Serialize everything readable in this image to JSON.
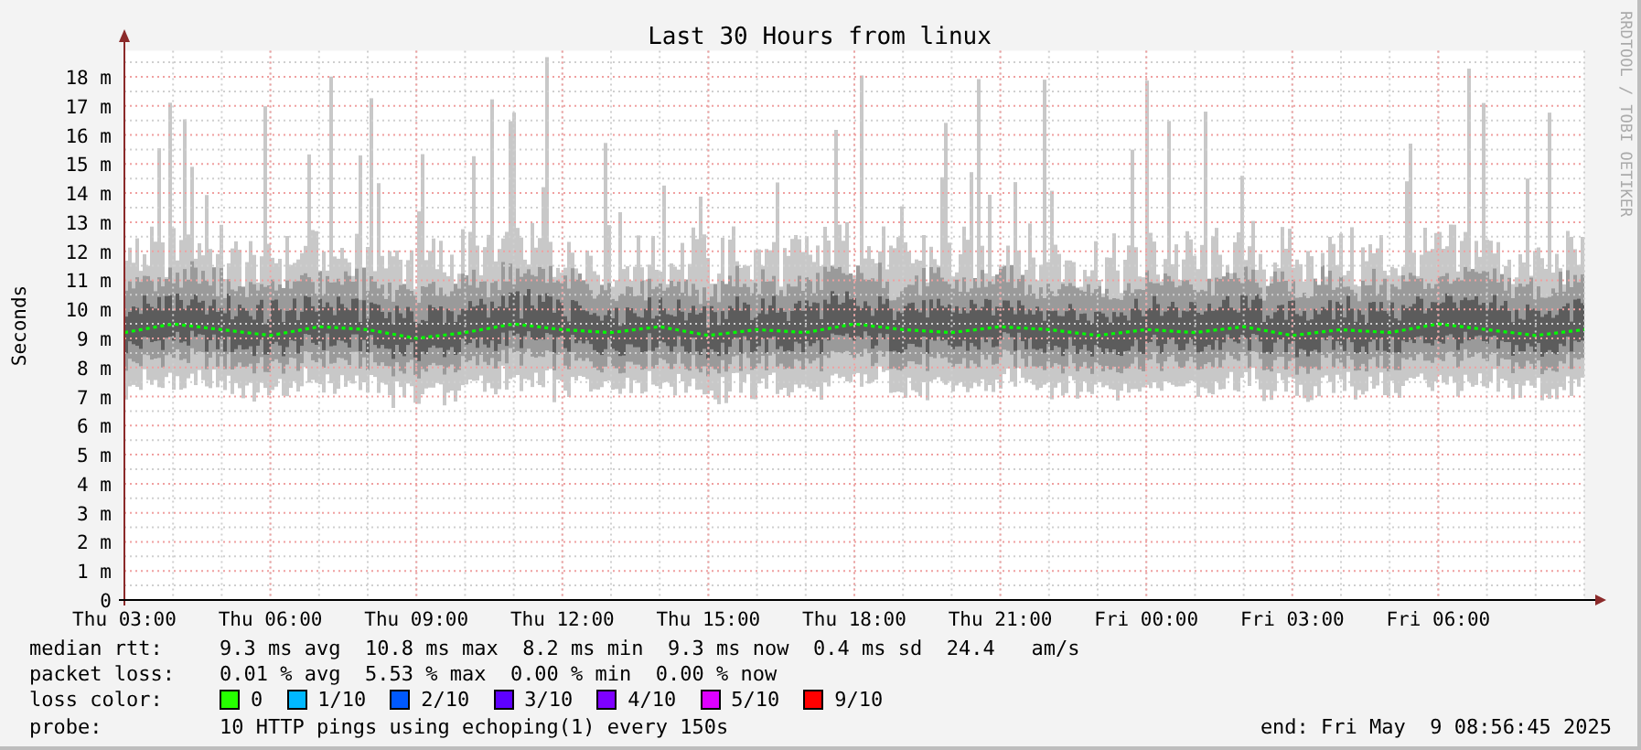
{
  "chart": {
    "chart_data": {
      "type": "line",
      "title": "Last 30 Hours from linux",
      "ylabel": "Seconds",
      "ylim": [
        0,
        18.9
      ],
      "categories": [
        "Thu 03:00",
        null,
        null,
        "Thu 06:00",
        null,
        null,
        "Thu 09:00",
        null,
        null,
        "Thu 12:00",
        null,
        null,
        "Thu 15:00",
        null,
        null,
        "Thu 18:00",
        null,
        null,
        "Thu 21:00",
        null,
        null,
        "Fri 00:00",
        null,
        null,
        "Fri 03:00",
        null,
        null,
        "Fri 06:00",
        null,
        null,
        null
      ],
      "yticks": [
        {
          "value": 0,
          "label": "0"
        },
        {
          "value": 1,
          "label": "1 m"
        },
        {
          "value": 2,
          "label": "2 m"
        },
        {
          "value": 3,
          "label": "3 m"
        },
        {
          "value": 4,
          "label": "4 m"
        },
        {
          "value": 5,
          "label": "5 m"
        },
        {
          "value": 6,
          "label": "6 m"
        },
        {
          "value": 7,
          "label": "7 m"
        },
        {
          "value": 8,
          "label": "8 m"
        },
        {
          "value": 9,
          "label": "9 m"
        },
        {
          "value": 10,
          "label": "10 m"
        },
        {
          "value": 11,
          "label": "11 m"
        },
        {
          "value": 12,
          "label": "12 m"
        },
        {
          "value": 13,
          "label": "13 m"
        },
        {
          "value": 14,
          "label": "14 m"
        },
        {
          "value": 15,
          "label": "15 m"
        },
        {
          "value": 16,
          "label": "16 m"
        },
        {
          "value": 17,
          "label": "17 m"
        },
        {
          "value": 18,
          "label": "18 m"
        }
      ],
      "grid": true,
      "series": [
        {
          "color": "#00ff00",
          "line_style": "dotted",
          "values": [
            9.2,
            9.5,
            9.3,
            9.1,
            9.4,
            9.3,
            9.0,
            9.2,
            9.5,
            9.3,
            9.2,
            9.4,
            9.1,
            9.3,
            9.2,
            9.5,
            9.3,
            9.2,
            9.4,
            9.3,
            9.1,
            9.3,
            9.2,
            9.4,
            9.1,
            9.3,
            9.2,
            9.5,
            9.3,
            9.1,
            9.3
          ]
        }
      ]
    }
  },
  "attribution": "RRDTOOL / TOBI OETIKER",
  "legend": {
    "lines": [
      {
        "label": "median rtt:",
        "text": "9.3 ms avg  10.8 ms max  8.2 ms min  9.3 ms now  0.4 ms sd  24.4   am/s"
      },
      {
        "label": "packet loss:",
        "text": "0.01 % avg  5.53 % max  0.00 % min  0.00 % now"
      }
    ],
    "loss_color": {
      "label": "loss color:",
      "items": [
        {
          "label": "0",
          "color": "#26ff00"
        },
        {
          "label": "1/10",
          "color": "#00b8ff"
        },
        {
          "label": "2/10",
          "color": "#0059ff"
        },
        {
          "label": "3/10",
          "color": "#5e00ff"
        },
        {
          "label": "4/10",
          "color": "#7e00ff"
        },
        {
          "label": "5/10",
          "color": "#dd00ff"
        },
        {
          "label": "9/10",
          "color": "#ff0000"
        }
      ]
    },
    "probe": {
      "label": "probe:",
      "text": "10 HTTP pings using echoping(1) every 150s"
    },
    "end": "end: Fri May  9 08:56:45 2025"
  }
}
